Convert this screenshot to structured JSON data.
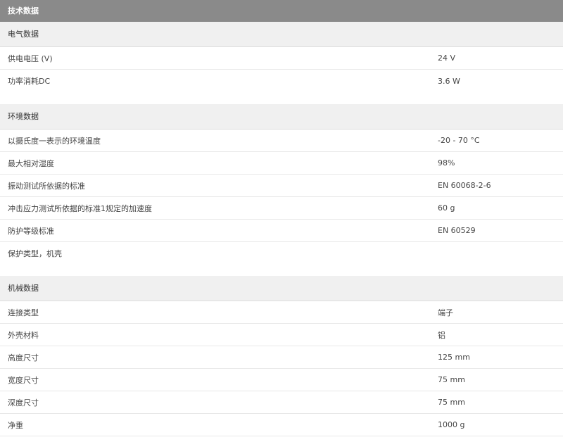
{
  "title": "技术数据",
  "sections": [
    {
      "header": "电气数据",
      "rows": [
        {
          "label": "供电电压 (V)",
          "value": "24  V"
        },
        {
          "label": "功率消耗DC",
          "value": "3.6  W"
        }
      ]
    },
    {
      "header": "环境数据",
      "rows": [
        {
          "label": "以摄氏度一表示的环境温度",
          "value": "-20 - 70  °C"
        },
        {
          "label": "最大相对湿度",
          "value": "98%"
        },
        {
          "label": "振动测试所依据的标准",
          "value": "EN 60068-2-6"
        },
        {
          "label": "冲击应力测试所依据的标准1规定的加速度",
          "value": "60 g"
        },
        {
          "label": "防护等级标准",
          "value": "EN 60529"
        },
        {
          "label": "保护类型，机壳",
          "value": ""
        }
      ]
    },
    {
      "header": "机械数据",
      "rows": [
        {
          "label": "连接类型",
          "value": "端子"
        },
        {
          "label": "外壳材料",
          "value": "铝"
        },
        {
          "label": "高度尺寸",
          "value": "125  mm"
        },
        {
          "label": "宽度尺寸",
          "value": "75  mm"
        },
        {
          "label": "深度尺寸",
          "value": "75  mm"
        },
        {
          "label": "净重",
          "value": "1000  g"
        }
      ]
    }
  ]
}
